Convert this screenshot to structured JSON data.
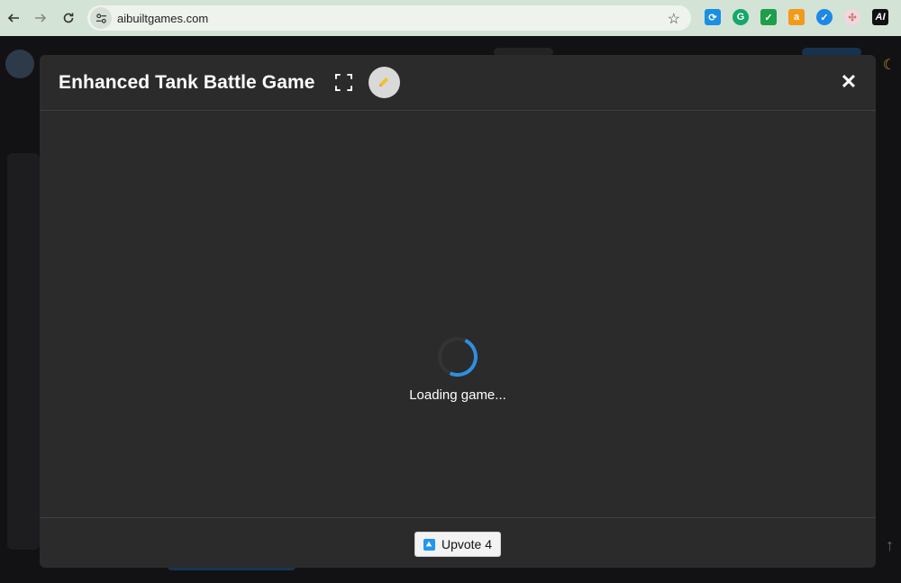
{
  "browser": {
    "url": "aibuiltgames.com",
    "extensions": [
      "refresh-ext-icon",
      "grammarly-icon",
      "check-ext-icon",
      "amazon-icon",
      "verified-ext-icon",
      "color-ext-icon",
      "ai-ext-icon"
    ],
    "ai_label": "AI",
    "amazon_label": "a"
  },
  "modal": {
    "title": "Enhanced Tank Battle Game",
    "loading_text": "Loading game...",
    "close_symbol": "✕",
    "upvote": {
      "label": "Upvote 4",
      "count": 4
    }
  },
  "colors": {
    "accent": "#2f8fe0",
    "modal_bg": "#2b2b2b",
    "browser_bar": "#d3e3d6"
  }
}
